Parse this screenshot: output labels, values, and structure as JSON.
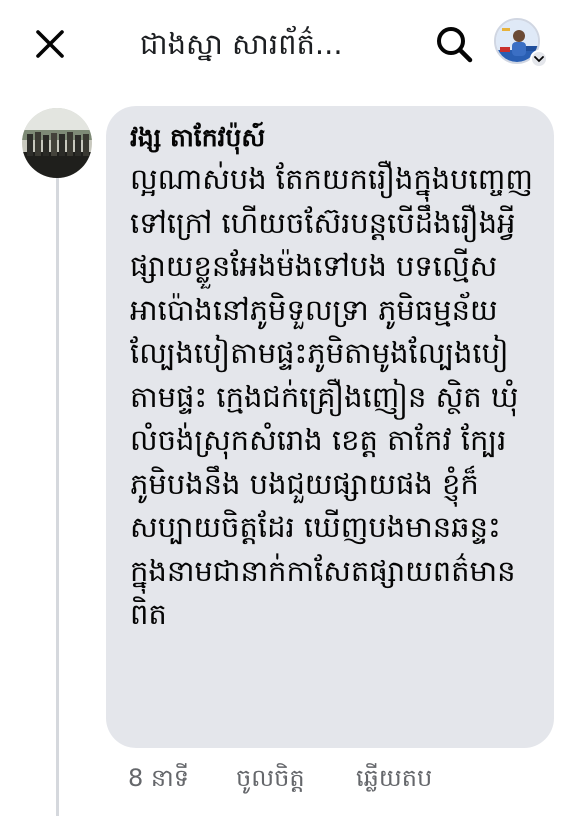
{
  "header": {
    "title": "ជាងស្នា សារព័ត៌...",
    "icons": {
      "close": "close-icon",
      "search": "search-icon",
      "profile": "profile-avatar",
      "chevron": "chevron-down-icon"
    }
  },
  "comment": {
    "author": "វង្ស តាកែវប៉ុស៍",
    "text": "ល្អណាស់បង តែកយករឿងក្នុងបញ្ចេញទៅក្រៅ ហើយចស៊ែរបន្តបើដឹងរឿងអ្វីផ្សាយខ្លួនអែងម៉ងទៅបង បទល្មើសអាប៉ោងនៅភូមិទួលទ្រា ភូមិធម្មន័យ ល្បែងបៀតាមផ្ទះភូមិតាមូងល្បែងបៀតាមផ្ទះ ក្មេងជក់គ្រឿងញៀន ស្ថិត ឃុំ លំចង់ស្រុកសំរោង ខេត្ត តាកែវ ក្បែរ ភូមិបងនឹង បងជួយផ្សាយផង ខ្ញុំក៏សប្បាយចិត្តដែរ ឃើញបងមានឆន្ទះក្នុងនាមជានាក់កាសែតផ្សាយពត៌មានពិត",
    "time": "8 នាទី",
    "like_label": "ចូលចិត្ត",
    "reply_label": "ឆ្លើយតប"
  },
  "colors": {
    "bubble": "#e4e6eb",
    "meta_text": "#65676b",
    "thread_line": "#d5d8dd"
  }
}
